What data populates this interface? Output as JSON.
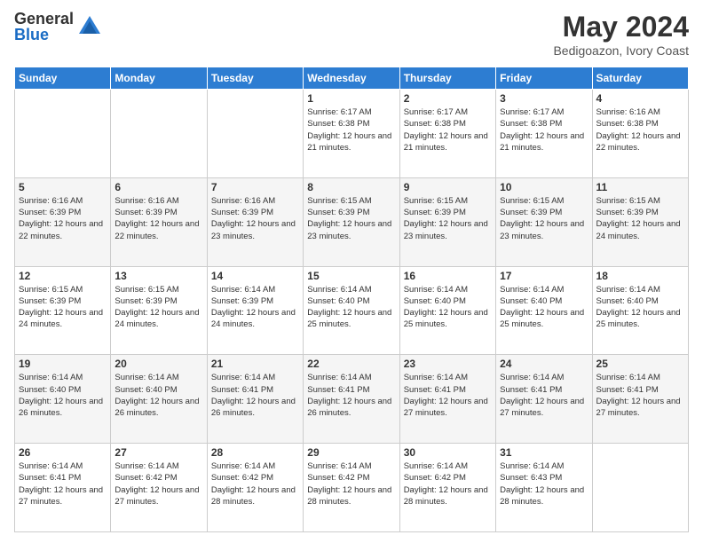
{
  "logo": {
    "general": "General",
    "blue": "Blue"
  },
  "header": {
    "month": "May 2024",
    "location": "Bedigoazon, Ivory Coast"
  },
  "weekdays": [
    "Sunday",
    "Monday",
    "Tuesday",
    "Wednesday",
    "Thursday",
    "Friday",
    "Saturday"
  ],
  "weeks": [
    [
      {
        "day": "",
        "info": ""
      },
      {
        "day": "",
        "info": ""
      },
      {
        "day": "",
        "info": ""
      },
      {
        "day": "1",
        "info": "Sunrise: 6:17 AM\nSunset: 6:38 PM\nDaylight: 12 hours and 21 minutes."
      },
      {
        "day": "2",
        "info": "Sunrise: 6:17 AM\nSunset: 6:38 PM\nDaylight: 12 hours and 21 minutes."
      },
      {
        "day": "3",
        "info": "Sunrise: 6:17 AM\nSunset: 6:38 PM\nDaylight: 12 hours and 21 minutes."
      },
      {
        "day": "4",
        "info": "Sunrise: 6:16 AM\nSunset: 6:38 PM\nDaylight: 12 hours and 22 minutes."
      }
    ],
    [
      {
        "day": "5",
        "info": "Sunrise: 6:16 AM\nSunset: 6:39 PM\nDaylight: 12 hours and 22 minutes."
      },
      {
        "day": "6",
        "info": "Sunrise: 6:16 AM\nSunset: 6:39 PM\nDaylight: 12 hours and 22 minutes."
      },
      {
        "day": "7",
        "info": "Sunrise: 6:16 AM\nSunset: 6:39 PM\nDaylight: 12 hours and 23 minutes."
      },
      {
        "day": "8",
        "info": "Sunrise: 6:15 AM\nSunset: 6:39 PM\nDaylight: 12 hours and 23 minutes."
      },
      {
        "day": "9",
        "info": "Sunrise: 6:15 AM\nSunset: 6:39 PM\nDaylight: 12 hours and 23 minutes."
      },
      {
        "day": "10",
        "info": "Sunrise: 6:15 AM\nSunset: 6:39 PM\nDaylight: 12 hours and 23 minutes."
      },
      {
        "day": "11",
        "info": "Sunrise: 6:15 AM\nSunset: 6:39 PM\nDaylight: 12 hours and 24 minutes."
      }
    ],
    [
      {
        "day": "12",
        "info": "Sunrise: 6:15 AM\nSunset: 6:39 PM\nDaylight: 12 hours and 24 minutes."
      },
      {
        "day": "13",
        "info": "Sunrise: 6:15 AM\nSunset: 6:39 PM\nDaylight: 12 hours and 24 minutes."
      },
      {
        "day": "14",
        "info": "Sunrise: 6:14 AM\nSunset: 6:39 PM\nDaylight: 12 hours and 24 minutes."
      },
      {
        "day": "15",
        "info": "Sunrise: 6:14 AM\nSunset: 6:40 PM\nDaylight: 12 hours and 25 minutes."
      },
      {
        "day": "16",
        "info": "Sunrise: 6:14 AM\nSunset: 6:40 PM\nDaylight: 12 hours and 25 minutes."
      },
      {
        "day": "17",
        "info": "Sunrise: 6:14 AM\nSunset: 6:40 PM\nDaylight: 12 hours and 25 minutes."
      },
      {
        "day": "18",
        "info": "Sunrise: 6:14 AM\nSunset: 6:40 PM\nDaylight: 12 hours and 25 minutes."
      }
    ],
    [
      {
        "day": "19",
        "info": "Sunrise: 6:14 AM\nSunset: 6:40 PM\nDaylight: 12 hours and 26 minutes."
      },
      {
        "day": "20",
        "info": "Sunrise: 6:14 AM\nSunset: 6:40 PM\nDaylight: 12 hours and 26 minutes."
      },
      {
        "day": "21",
        "info": "Sunrise: 6:14 AM\nSunset: 6:41 PM\nDaylight: 12 hours and 26 minutes."
      },
      {
        "day": "22",
        "info": "Sunrise: 6:14 AM\nSunset: 6:41 PM\nDaylight: 12 hours and 26 minutes."
      },
      {
        "day": "23",
        "info": "Sunrise: 6:14 AM\nSunset: 6:41 PM\nDaylight: 12 hours and 27 minutes."
      },
      {
        "day": "24",
        "info": "Sunrise: 6:14 AM\nSunset: 6:41 PM\nDaylight: 12 hours and 27 minutes."
      },
      {
        "day": "25",
        "info": "Sunrise: 6:14 AM\nSunset: 6:41 PM\nDaylight: 12 hours and 27 minutes."
      }
    ],
    [
      {
        "day": "26",
        "info": "Sunrise: 6:14 AM\nSunset: 6:41 PM\nDaylight: 12 hours and 27 minutes."
      },
      {
        "day": "27",
        "info": "Sunrise: 6:14 AM\nSunset: 6:42 PM\nDaylight: 12 hours and 27 minutes."
      },
      {
        "day": "28",
        "info": "Sunrise: 6:14 AM\nSunset: 6:42 PM\nDaylight: 12 hours and 28 minutes."
      },
      {
        "day": "29",
        "info": "Sunrise: 6:14 AM\nSunset: 6:42 PM\nDaylight: 12 hours and 28 minutes."
      },
      {
        "day": "30",
        "info": "Sunrise: 6:14 AM\nSunset: 6:42 PM\nDaylight: 12 hours and 28 minutes."
      },
      {
        "day": "31",
        "info": "Sunrise: 6:14 AM\nSunset: 6:43 PM\nDaylight: 12 hours and 28 minutes."
      },
      {
        "day": "",
        "info": ""
      }
    ]
  ]
}
